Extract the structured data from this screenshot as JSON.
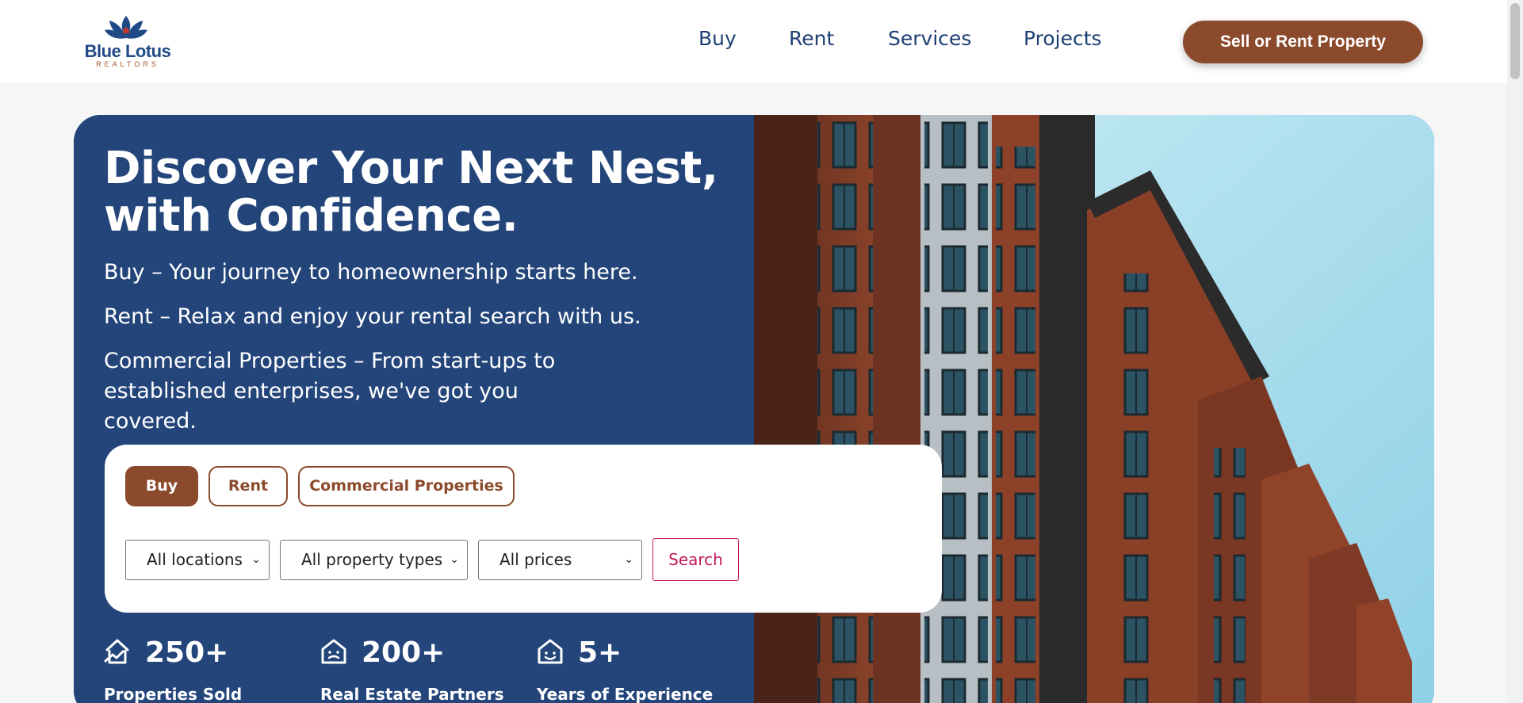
{
  "brand": {
    "name": "Blue Lotus",
    "tagline": "REALTORS",
    "primary_color": "#23457a",
    "accent_color": "#8b4a2b",
    "search_color": "#c2185b"
  },
  "nav": {
    "items": [
      {
        "label": "Buy"
      },
      {
        "label": "Rent"
      },
      {
        "label": "Services"
      },
      {
        "label": "Projects"
      }
    ],
    "cta_label": "Sell or Rent Property"
  },
  "hero": {
    "title": "Discover Your Next Nest, with Confidence.",
    "lines": [
      "Buy – Your journey to homeownership starts here.",
      "Rent – Relax and enjoy your rental search with us.",
      "Commercial Properties – From start-ups to established enterprises, we've got you covered."
    ],
    "image": "apartment-building-photo"
  },
  "search": {
    "tabs": [
      {
        "label": "Buy",
        "active": true
      },
      {
        "label": "Rent",
        "active": false
      },
      {
        "label": "Commercial Properties",
        "active": false
      }
    ],
    "filters": {
      "location": "All locations",
      "property_type": "All property types",
      "price": "All prices"
    },
    "button_label": "Search"
  },
  "stats": [
    {
      "value": "250+",
      "label": "Properties Sold",
      "icon": "house-trend-icon"
    },
    {
      "value": "200+",
      "label": "Real Estate Partners",
      "icon": "house-smile-icon"
    },
    {
      "value": "5+",
      "label": "Years of Experience",
      "icon": "house-face-icon"
    }
  ]
}
